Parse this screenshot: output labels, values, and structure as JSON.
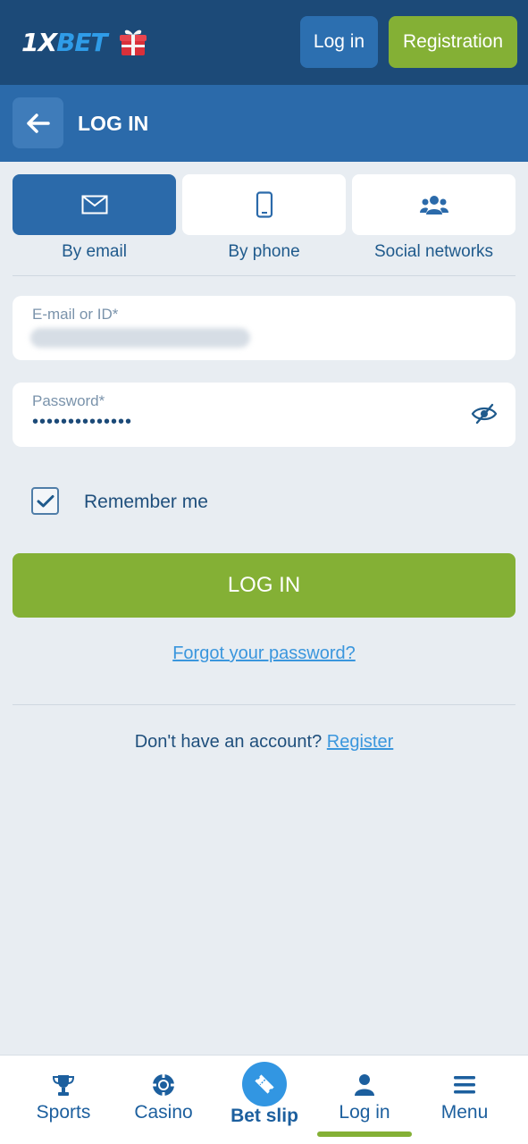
{
  "header": {
    "logo_main": "1X",
    "logo_accent": "BET",
    "login_label": "Log in",
    "registration_label": "Registration"
  },
  "titlebar": {
    "title": "LOG IN"
  },
  "methods": [
    {
      "label": "By email",
      "icon": "envelope-icon",
      "active": true
    },
    {
      "label": "By phone",
      "icon": "phone-icon",
      "active": false
    },
    {
      "label": "Social networks",
      "icon": "users-icon",
      "active": false
    }
  ],
  "form": {
    "email_label": "E-mail or ID*",
    "password_label": "Password*",
    "password_value": "••••••••••••••",
    "remember_label": "Remember me",
    "remember_checked": true,
    "submit_label": "LOG IN",
    "forgot_label": "Forgot your password?",
    "no_account_text": "Don't have an account?",
    "register_link": "Register"
  },
  "bottom_nav": {
    "items": [
      {
        "label": "Sports",
        "icon": "trophy-icon"
      },
      {
        "label": "Casino",
        "icon": "chip-icon"
      },
      {
        "label": "Bet slip",
        "icon": "ticket-icon"
      },
      {
        "label": "Log in",
        "icon": "user-icon",
        "active": true
      },
      {
        "label": "Menu",
        "icon": "hamburger-icon"
      }
    ]
  },
  "colors": {
    "header_bg": "#1c4a78",
    "titlebar_bg": "#2b6aaa",
    "accent_green": "#84b035",
    "link_blue": "#3a96dd",
    "page_bg": "#e8edf2"
  }
}
